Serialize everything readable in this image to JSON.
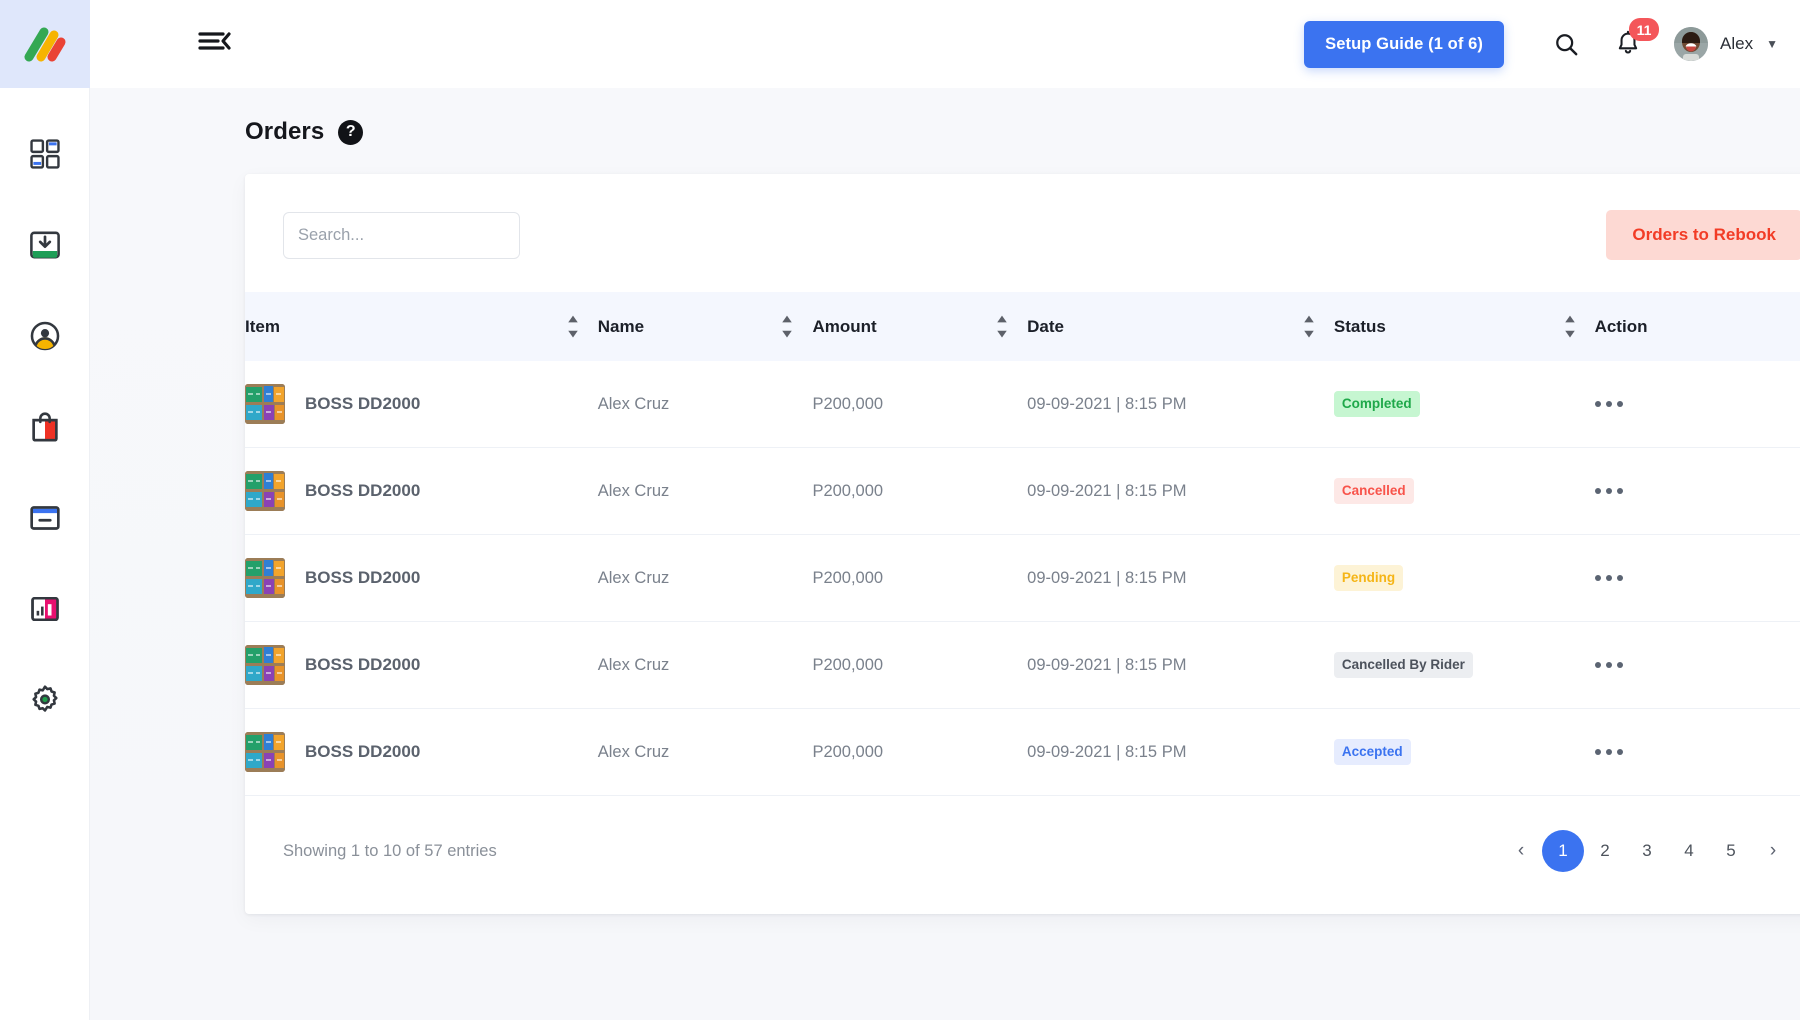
{
  "brand": {
    "logo_name": "multi-chevron-logo",
    "accent": "#3b73f0"
  },
  "sidebar": {
    "items": [
      {
        "name": "dashboard",
        "icon": "dashboard-grid-icon"
      },
      {
        "name": "inbox",
        "icon": "inbox-download-icon"
      },
      {
        "name": "account",
        "icon": "user-circle-icon"
      },
      {
        "name": "products",
        "icon": "shopping-bag-icon"
      },
      {
        "name": "wallet",
        "icon": "wallet-card-icon"
      },
      {
        "name": "reports",
        "icon": "bar-chart-icon"
      },
      {
        "name": "settings",
        "icon": "gear-icon"
      }
    ]
  },
  "topbar": {
    "menu_toggle_icon": "hamburger-collapse-icon",
    "setup_guide_prefix": "Setup Guide (",
    "setup_guide_count": "1 of 6",
    "setup_guide_suffix": ")",
    "search_icon": "search-icon",
    "bell_icon": "bell-icon",
    "notification_count": "11",
    "user_name": "Alex",
    "caret_icon": "chevron-down-icon"
  },
  "page": {
    "title": "Orders",
    "help_label": "?"
  },
  "toolbar": {
    "search_placeholder": "Search...",
    "search_value": "",
    "search_icon": "search-icon",
    "rebook_label": "Orders to Rebook"
  },
  "table": {
    "columns": [
      {
        "key": "item",
        "label": "Item",
        "sortable": true
      },
      {
        "key": "name",
        "label": "Name",
        "sortable": true
      },
      {
        "key": "amount",
        "label": "Amount",
        "sortable": true
      },
      {
        "key": "date",
        "label": "Date",
        "sortable": true
      },
      {
        "key": "status",
        "label": "Status",
        "sortable": true
      },
      {
        "key": "action",
        "label": "Action",
        "sortable": false
      }
    ],
    "rows": [
      {
        "item": "BOSS DD2000",
        "name": "Alex Cruz",
        "amount": "P200,000",
        "date": "09-09-2021 | 8:15 PM",
        "status": "Completed",
        "status_class": "st-completed",
        "thumb": "product-thumbnail"
      },
      {
        "item": "BOSS DD2000",
        "name": "Alex Cruz",
        "amount": "P200,000",
        "date": "09-09-2021 | 8:15 PM",
        "status": "Cancelled",
        "status_class": "st-cancelled",
        "thumb": "product-thumbnail"
      },
      {
        "item": "BOSS DD2000",
        "name": "Alex Cruz",
        "amount": "P200,000",
        "date": "09-09-2021 | 8:15 PM",
        "status": "Pending",
        "status_class": "st-pending",
        "thumb": "product-thumbnail"
      },
      {
        "item": "BOSS DD2000",
        "name": "Alex Cruz",
        "amount": "P200,000",
        "date": "09-09-2021 | 8:15 PM",
        "status": "Cancelled By Rider",
        "status_class": "st-rider",
        "thumb": "product-thumbnail"
      },
      {
        "item": "BOSS DD2000",
        "name": "Alex Cruz",
        "amount": "P200,000",
        "date": "09-09-2021 | 8:15 PM",
        "status": "Accepted",
        "status_class": "st-accepted",
        "thumb": "product-thumbnail"
      }
    ],
    "action_icon": "more-options-dots-icon"
  },
  "footer": {
    "entries_text": "Showing 1 to 10 of 57 entries",
    "prev_icon": "chevron-left-icon",
    "next_icon": "chevron-right-icon",
    "pages": [
      "1",
      "2",
      "3",
      "4",
      "5"
    ],
    "active_page": "1"
  },
  "colors": {
    "primary_blue": "#3b73f0",
    "rebook_bg": "#fdd9d3",
    "rebook_text": "#f23c26",
    "badge_red": "#f4565a",
    "header_row_bg": "#f4f7fe",
    "page_bg": "#f7f8fb"
  }
}
